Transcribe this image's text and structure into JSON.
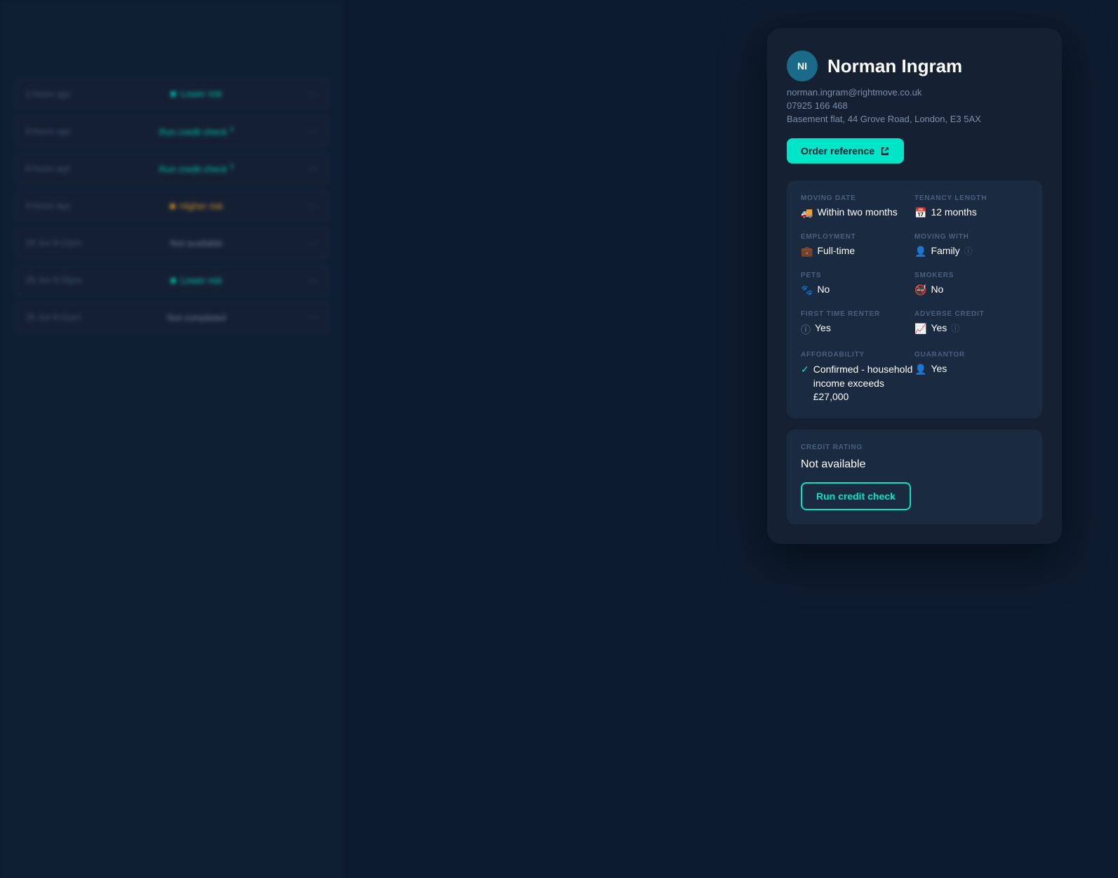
{
  "background": {
    "color": "#0d1b2e"
  },
  "list_panel": {
    "rows": [
      {
        "time": "2 hours ago",
        "status": "Lower risk",
        "status_type": "cyan_dot",
        "has_icon": true
      },
      {
        "time": "8 hours ago",
        "status": "Run credit check",
        "status_type": "cyan_text",
        "badge": "1",
        "has_icon": true
      },
      {
        "time": "8 hours ago",
        "status": "Run credit check",
        "status_type": "cyan_text",
        "badge": "1",
        "has_icon": true
      },
      {
        "time": "8 hours ago",
        "status": "Higher risk",
        "status_type": "amber_dot",
        "has_icon": true
      },
      {
        "time": "26 Jun 8:12pm",
        "status": "Not available",
        "status_type": "gray",
        "has_icon": true
      },
      {
        "time": "26 Jun 8:16pm",
        "status": "Lower risk",
        "status_type": "cyan_dot",
        "has_icon": true
      },
      {
        "time": "26 Jun 8:11pm",
        "status": "Not completed",
        "status_type": "gray",
        "has_icon": true
      }
    ]
  },
  "profile": {
    "initials": "NI",
    "name": "Norman Ingram",
    "email": "norman.ingram@rightmove.co.uk",
    "phone": "07925 166 468",
    "address": "Basement flat, 44 Grove Road, London, E3 5AX",
    "order_ref_label": "Order reference"
  },
  "info_fields": {
    "moving_date_label": "MOVING DATE",
    "moving_date_value": "Within two months",
    "tenancy_length_label": "TENANCY LENGTH",
    "tenancy_length_value": "12 months",
    "employment_label": "EMPLOYMENT",
    "employment_value": "Full-time",
    "moving_with_label": "MOVING WITH",
    "moving_with_value": "Family",
    "pets_label": "PETS",
    "pets_value": "No",
    "smokers_label": "SMOKERS",
    "smokers_value": "No",
    "first_time_renter_label": "FIRST TIME RENTER",
    "first_time_renter_value": "Yes",
    "adverse_credit_label": "ADVERSE CREDIT",
    "adverse_credit_value": "Yes",
    "affordability_label": "AFFORDABILITY",
    "affordability_value": "Confirmed - household income exceeds £27,000",
    "guarantor_label": "GUARANTOR",
    "guarantor_value": "Yes"
  },
  "credit": {
    "label": "CREDIT RATING",
    "value": "Not available",
    "button_label": "Run credit check"
  },
  "colors": {
    "accent": "#00e5c8",
    "card_bg": "#162033",
    "info_bg": "#1a2a40",
    "text_primary": "#ffffff",
    "text_secondary": "#7a8fa8",
    "text_muted": "#4a6080"
  }
}
